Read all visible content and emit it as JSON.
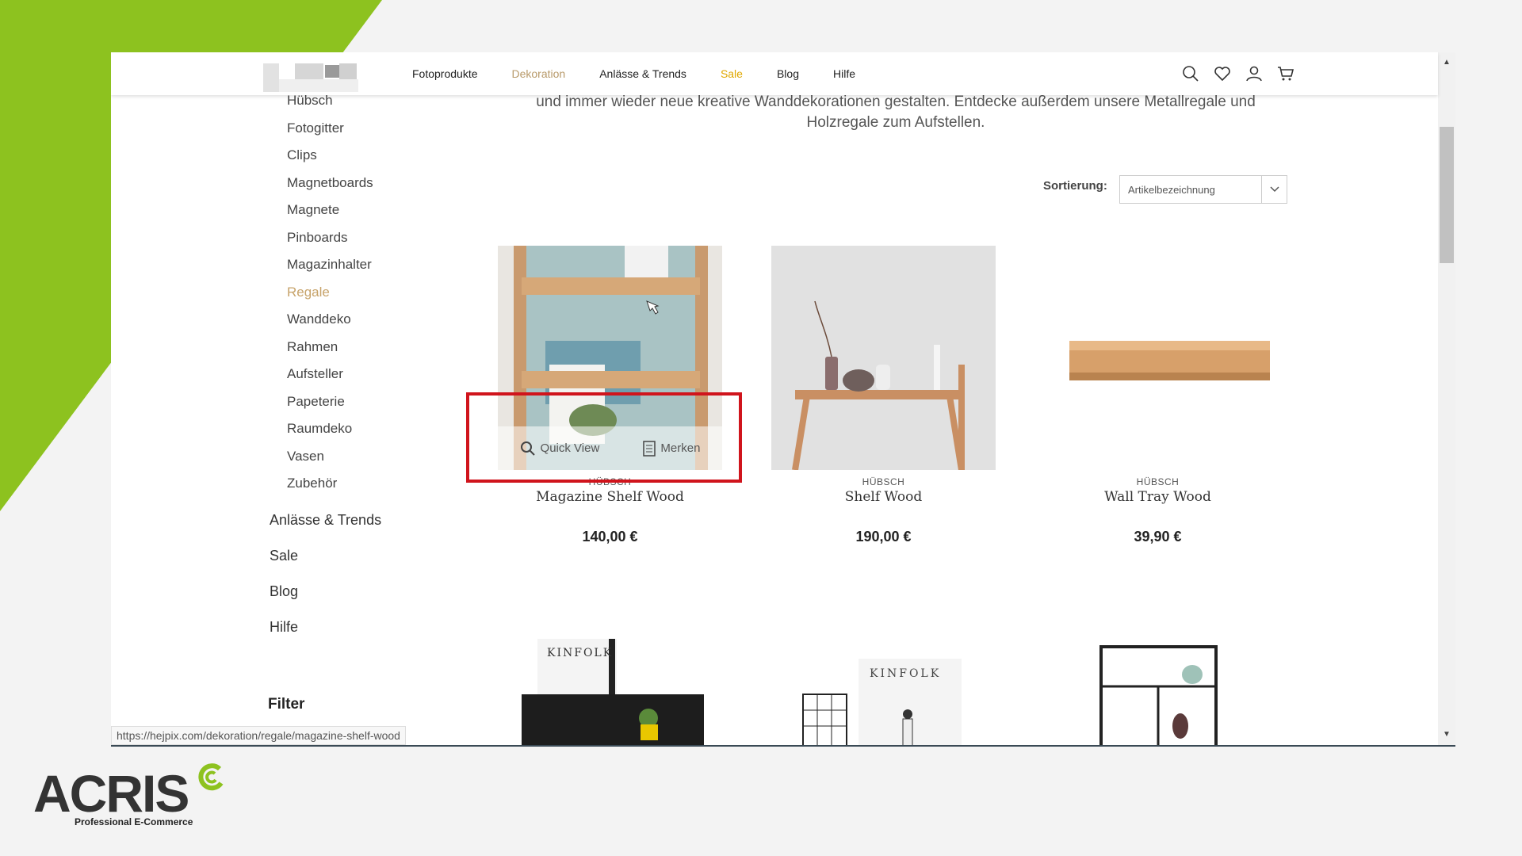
{
  "colors": {
    "brand_green": "#8dc21f",
    "active_category": "#c7a36a",
    "sale": "#e0a800",
    "highlight_box": "#d0141c"
  },
  "header": {
    "nav": [
      {
        "label": "Fotoprodukte",
        "state": "normal"
      },
      {
        "label": "Dekoration",
        "state": "active"
      },
      {
        "label": "Anlässe & Trends",
        "state": "normal"
      },
      {
        "label": "Sale",
        "state": "sale"
      },
      {
        "label": "Blog",
        "state": "normal"
      },
      {
        "label": "Hilfe",
        "state": "normal"
      }
    ],
    "icons": [
      "search-icon",
      "heart-icon",
      "user-icon",
      "cart-icon"
    ]
  },
  "sidebar": {
    "subcategories": [
      "Hübsch",
      "Fotogitter",
      "Clips",
      "Magnetboards",
      "Magnete",
      "Pinboards",
      "Magazinhalter",
      "Regale",
      "Wanddeko",
      "Rahmen",
      "Aufsteller",
      "Papeterie",
      "Raumdeko",
      "Vasen",
      "Zubehör"
    ],
    "active_subcategory": "Regale",
    "main_categories": [
      "Anlässe & Trends",
      "Sale",
      "Blog",
      "Hilfe"
    ],
    "filter_label": "Filter"
  },
  "intro_text": "und immer wieder neue kreative Wanddekorationen gestalten. Entdecke außerdem unsere Metallregale und Holzregale zum Aufstellen.",
  "sorting": {
    "label": "Sortierung:",
    "value": "Artikelbezeichnung"
  },
  "products": [
    {
      "brand": "HÜBSCH",
      "name": "Magazine Shelf Wood",
      "price": "140,00 €",
      "quick_view": "Quick View",
      "wishlist": "Merken"
    },
    {
      "brand": "HÜBSCH",
      "name": "Shelf Wood",
      "price": "190,00 €"
    },
    {
      "brand": "HÜBSCH",
      "name": "Wall Tray Wood",
      "price": "39,90 €"
    }
  ],
  "row2_labels": [
    "KINFOLK",
    "KINFOLK"
  ],
  "status_url": "https://hejpix.com/dekoration/regale/magazine-shelf-wood",
  "brand_logo": {
    "word": "ACRIS",
    "tagline": "Professional E-Commerce"
  }
}
